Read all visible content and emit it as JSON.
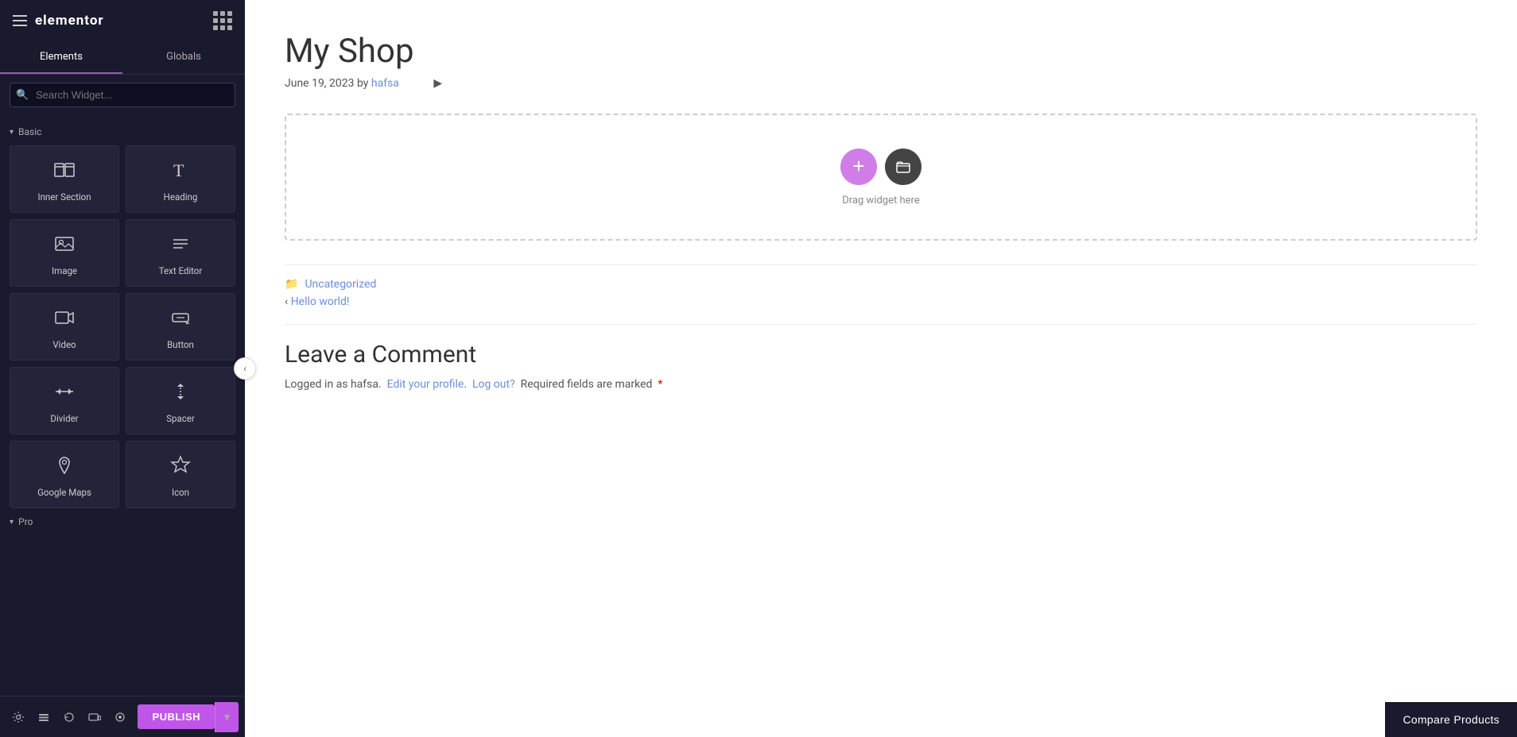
{
  "app": {
    "name": "elementor",
    "logo_text": "elementor"
  },
  "sidebar": {
    "tabs": [
      {
        "id": "elements",
        "label": "Elements",
        "active": true
      },
      {
        "id": "globals",
        "label": "Globals",
        "active": false
      }
    ],
    "search": {
      "placeholder": "Search Widget..."
    },
    "sections": [
      {
        "id": "basic",
        "label": "Basic",
        "widgets": [
          {
            "id": "inner-section",
            "label": "Inner Section",
            "icon": "inner-section"
          },
          {
            "id": "heading",
            "label": "Heading",
            "icon": "heading"
          },
          {
            "id": "image",
            "label": "Image",
            "icon": "image"
          },
          {
            "id": "text-editor",
            "label": "Text Editor",
            "icon": "text-editor"
          },
          {
            "id": "video",
            "label": "Video",
            "icon": "video"
          },
          {
            "id": "button",
            "label": "Button",
            "icon": "button"
          },
          {
            "id": "divider",
            "label": "Divider",
            "icon": "divider"
          },
          {
            "id": "spacer",
            "label": "Spacer",
            "icon": "spacer"
          },
          {
            "id": "google-maps",
            "label": "Google Maps",
            "icon": "google-maps"
          },
          {
            "id": "icon",
            "label": "Icon",
            "icon": "icon"
          }
        ]
      },
      {
        "id": "pro",
        "label": "Pro"
      }
    ]
  },
  "toolbar": {
    "settings_label": "Settings",
    "layers_label": "Layers",
    "history_label": "History",
    "responsive_label": "Responsive",
    "preview_label": "Preview",
    "publish_label": "PUBLISH",
    "expand_label": "▾"
  },
  "content": {
    "post_title": "My Shop",
    "post_meta": "June 19, 2023 by",
    "post_author": "hafsa",
    "drop_zone_hint": "Drag widget here",
    "add_button_label": "+",
    "folder_button_label": "📁",
    "footer": {
      "category_label": "Uncategorized",
      "prev_post_label": "Hello world!"
    },
    "comments": {
      "title": "Leave a Comment",
      "logged_in_prefix": "Logged in as hafsa.",
      "edit_profile_label": "Edit your profile",
      "logout_label": "Log out?",
      "required_text": "Required fields are marked",
      "required_star": "*"
    }
  },
  "compare_products": {
    "label": "Compare Products"
  }
}
